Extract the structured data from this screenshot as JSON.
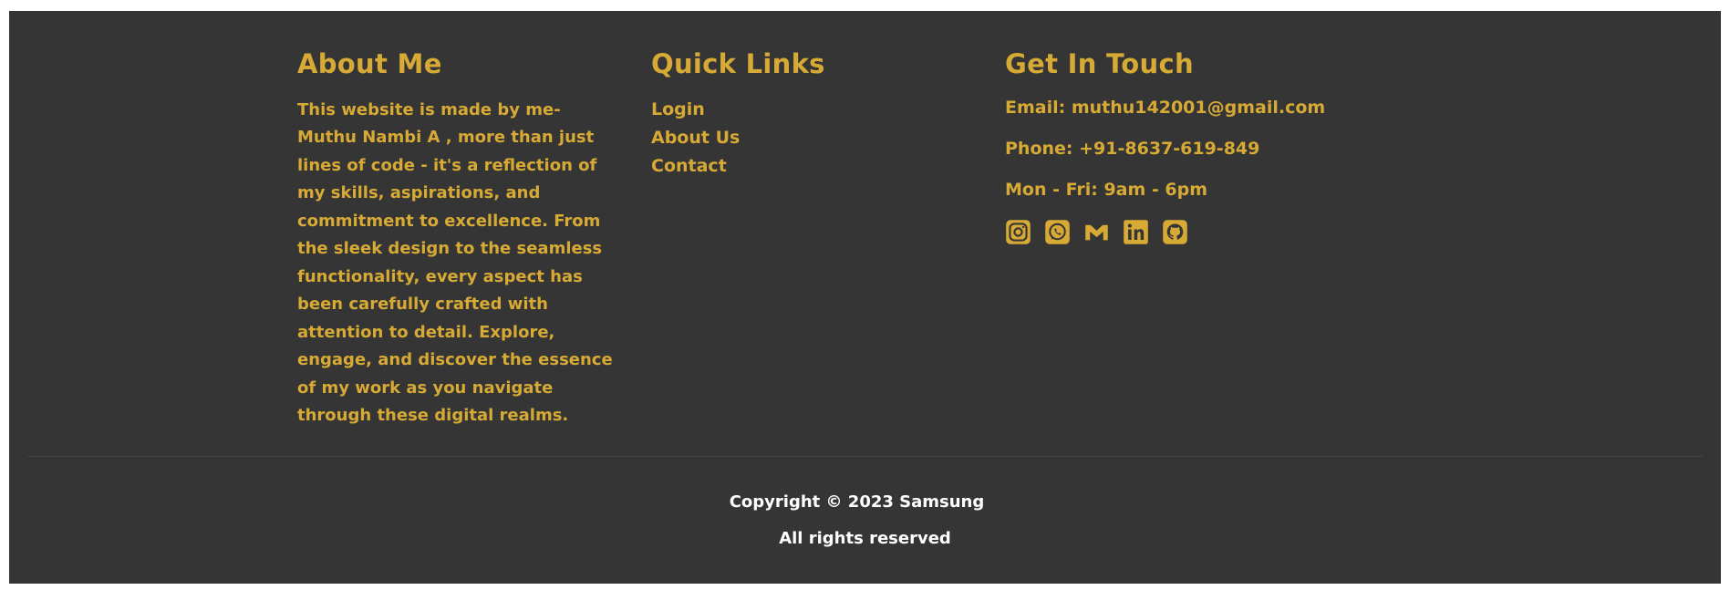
{
  "about": {
    "heading": "About Me",
    "text": "This website is made by me- Muthu Nambi A , more than just lines of code - it's a reflection of my skills, aspirations, and commitment to excellence. From the sleek design to the seamless functionality, every aspect has been carefully crafted with attention to detail. Explore, engage, and discover the essence of my work as you navigate through these digital realms."
  },
  "quick_links": {
    "heading": "Quick Links",
    "items": [
      {
        "label": "Login"
      },
      {
        "label": "About Us"
      },
      {
        "label": "Contact"
      }
    ]
  },
  "contact": {
    "heading": "Get In Touch",
    "email": "Email: muthu142001@gmail.com",
    "phone": "Phone: +91-8637-619-849",
    "hours": "Mon - Fri: 9am - 6pm",
    "social_icons": [
      "instagram-icon",
      "whatsapp-icon",
      "gmail-icon",
      "linkedin-icon",
      "github-icon"
    ]
  },
  "copyright": {
    "line1": "Copyright © 2023 Samsung",
    "line2": "All rights reserved"
  },
  "colors": {
    "background": "#353535",
    "accent": "#d7aa35",
    "copyright_text": "#ffffff"
  }
}
